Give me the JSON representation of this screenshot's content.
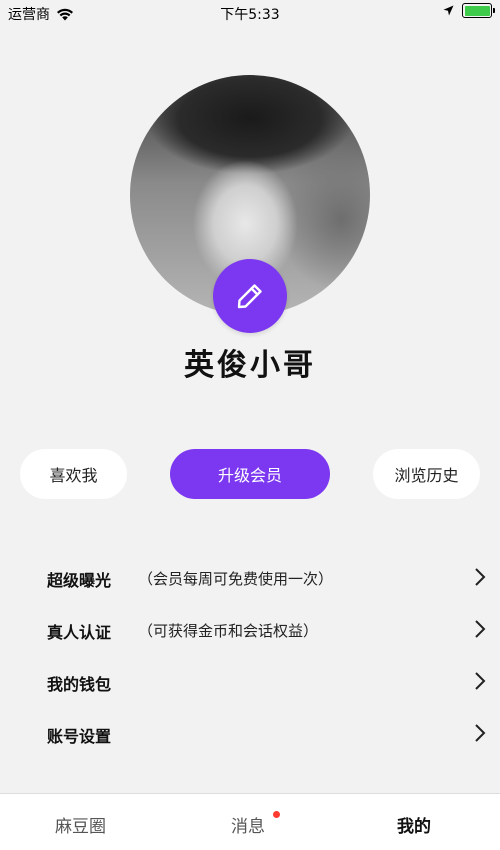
{
  "status_bar": {
    "carrier": "运营商",
    "time": "下午5:33",
    "battery_level": 1.0
  },
  "profile": {
    "name": "英俊小哥",
    "edit_icon": "pencil-icon",
    "accent_color": "#7b38f0"
  },
  "actions": {
    "liked_me": "喜欢我",
    "upgrade": "升级会员",
    "history": "浏览历史"
  },
  "menu": [
    {
      "title": "超级曝光",
      "subtitle": "（会员每周可免费使用一次）"
    },
    {
      "title": "真人认证",
      "subtitle": "（可获得金币和会话权益）"
    },
    {
      "title": "我的钱包",
      "subtitle": ""
    },
    {
      "title": "账号设置",
      "subtitle": ""
    }
  ],
  "tabs": [
    {
      "label": "麻豆圈",
      "active": false
    },
    {
      "label": "消息",
      "active": false,
      "badge": true
    },
    {
      "label": "我的",
      "active": true
    }
  ]
}
